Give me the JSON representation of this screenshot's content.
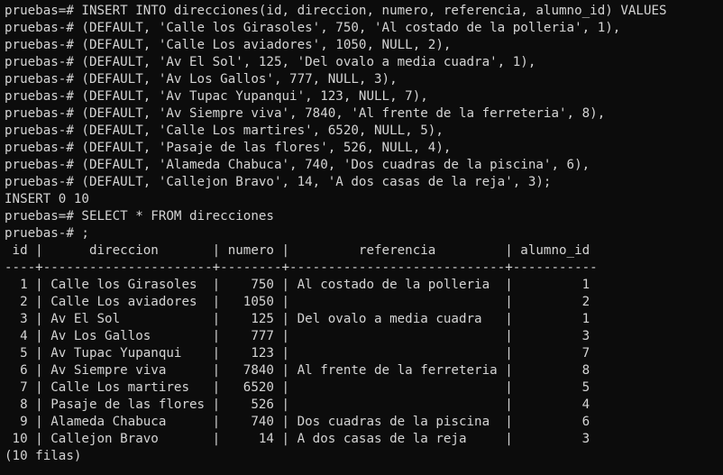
{
  "terminal": {
    "prompt": "pruebas=#",
    "cont_prompt": "pruebas-#",
    "insert_statement": [
      "pruebas=# INSERT INTO direcciones(id, direccion, numero, referencia, alumno_id) VALUES",
      "pruebas-# (DEFAULT, 'Calle los Girasoles', 750, 'Al costado de la polleria', 1),",
      "pruebas-# (DEFAULT, 'Calle Los aviadores', 1050, NULL, 2),",
      "pruebas-# (DEFAULT, 'Av El Sol', 125, 'Del ovalo a media cuadra', 1),",
      "pruebas-# (DEFAULT, 'Av Los Gallos', 777, NULL, 3),",
      "pruebas-# (DEFAULT, 'Av Tupac Yupanqui', 123, NULL, 7),",
      "pruebas-# (DEFAULT, 'Av Siempre viva', 7840, 'Al frente de la ferreteria', 8),",
      "pruebas-# (DEFAULT, 'Calle Los martires', 6520, NULL, 5),",
      "pruebas-# (DEFAULT, 'Pasaje de las flores', 526, NULL, 4),",
      "pruebas-# (DEFAULT, 'Alameda Chabuca', 740, 'Dos cuadras de la piscina', 6),",
      "pruebas-# (DEFAULT, 'Callejon Bravo', 14, 'A dos casas de la reja', 3);"
    ],
    "insert_result": "INSERT 0 10",
    "select_statement": [
      "pruebas=# SELECT * FROM direcciones",
      "pruebas-# ;"
    ],
    "table": {
      "header": " id |      direccion       | numero |         referencia         | alumno_id",
      "separator": "----+----------------------+--------+----------------------------+-----------",
      "rows": [
        "  1 | Calle los Girasoles  |    750 | Al costado de la polleria  |         1",
        "  2 | Calle Los aviadores  |   1050 |                            |         2",
        "  3 | Av El Sol            |    125 | Del ovalo a media cuadra   |         1",
        "  4 | Av Los Gallos        |    777 |                            |         3",
        "  5 | Av Tupac Yupanqui    |    123 |                            |         7",
        "  6 | Av Siempre viva      |   7840 | Al frente de la ferreteria |         8",
        "  7 | Calle Los martires   |   6520 |                            |         5",
        "  8 | Pasaje de las flores |    526 |                            |         4",
        "  9 | Alameda Chabuca      |    740 | Dos cuadras de la piscina  |         6",
        " 10 | Callejon Bravo       |     14 | A dos casas de la reja     |         3"
      ],
      "footer": "(10 filas)"
    },
    "colors": {
      "background": "#0c0c0c",
      "text": "#d4d4d4"
    }
  }
}
